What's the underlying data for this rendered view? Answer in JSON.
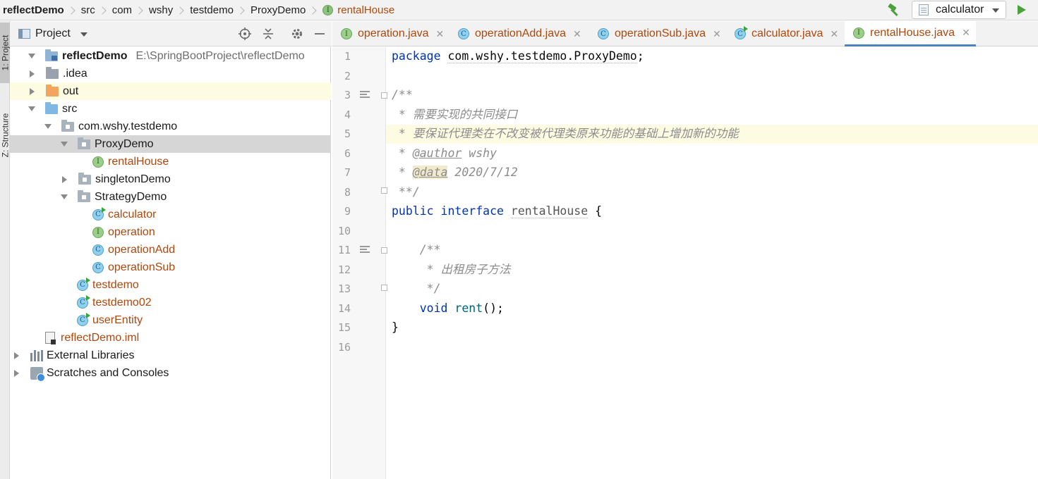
{
  "breadcrumb": {
    "items": [
      "reflectDemo",
      "src",
      "com",
      "wshy",
      "testdemo",
      "ProxyDemo"
    ],
    "current": "rentalHouse"
  },
  "toolbar": {
    "run_config": "calculator"
  },
  "left_strip": {
    "project_tab": "1: Project",
    "structure_tab": "Z: Structure"
  },
  "project_panel": {
    "title": "Project",
    "tree": [
      {
        "label": "reflectDemo",
        "path": "E:\\SpringBootProject\\reflectDemo"
      },
      {
        "label": ".idea"
      },
      {
        "label": "out"
      },
      {
        "label": "src"
      },
      {
        "label": "com.wshy.testdemo"
      },
      {
        "label": "ProxyDemo"
      },
      {
        "label": "rentalHouse"
      },
      {
        "label": "singletonDemo"
      },
      {
        "label": "StrategyDemo"
      },
      {
        "label": "calculator"
      },
      {
        "label": "operation"
      },
      {
        "label": "operationAdd"
      },
      {
        "label": "operationSub"
      },
      {
        "label": "testdemo"
      },
      {
        "label": "testdemo02"
      },
      {
        "label": "userEntity"
      },
      {
        "label": "reflectDemo.iml"
      },
      {
        "label": "External Libraries"
      },
      {
        "label": "Scratches and Consoles"
      }
    ]
  },
  "tabs": [
    {
      "label": "operation.java",
      "kind": "interface"
    },
    {
      "label": "operationAdd.java",
      "kind": "class"
    },
    {
      "label": "operationSub.java",
      "kind": "class"
    },
    {
      "label": "calculator.java",
      "kind": "class"
    },
    {
      "label": "rentalHouse.java",
      "kind": "interface",
      "active": true
    }
  ],
  "editor": {
    "line_numbers": [
      "1",
      "2",
      "3",
      "4",
      "5",
      "6",
      "7",
      "8",
      "9",
      "10",
      "11",
      "12",
      "13",
      "14",
      "15",
      "16"
    ],
    "code": {
      "l1_kw": "package",
      "l1_pkg": "com.wshy.testdemo.ProxyDemo",
      "l1_end": ";",
      "l3": "/**",
      "l4": " * 需要实现的共同接口",
      "l5": " * 要保证代理类在不改变被代理类原来功能的基础上增加新的功能",
      "l6_star": " * ",
      "l6_tag": "@author",
      "l6_val": " wshy",
      "l7_star": " * ",
      "l7_tag": "@data",
      "l7_val": " 2020/7/12",
      "l8": " **/",
      "l9_kw1": "public",
      "l9_kw2": "interface",
      "l9_name": "rentalHouse",
      "l9_brace": " {",
      "l11": "    /**",
      "l12": "     * 出租房子方法",
      "l13": "     */",
      "l14_kw": "    void",
      "l14_fn": "rent",
      "l14_end": "();",
      "l15": "}"
    }
  },
  "colors": {
    "accent": "#4a83c3",
    "keyword": "#0033b3",
    "comment": "#8c8c8c",
    "file_name": "#b3460b",
    "interface_badge": "#9bcf89",
    "class_badge": "#8fd0ee"
  }
}
